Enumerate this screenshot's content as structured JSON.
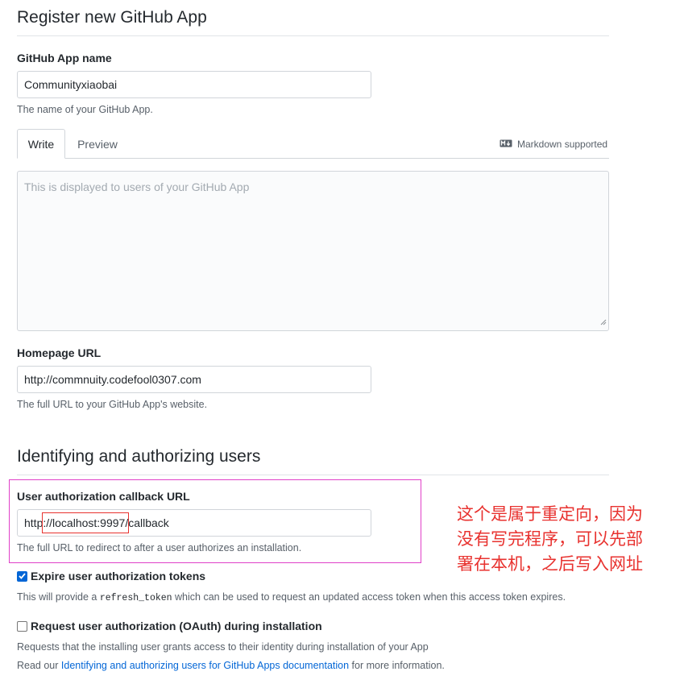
{
  "page": {
    "title": "Register new GitHub App"
  },
  "app_name": {
    "label": "GitHub App name",
    "value": "Communityxiaobai",
    "note": "The name of your GitHub App."
  },
  "description": {
    "tabs": [
      {
        "label": "Write",
        "active": true
      },
      {
        "label": "Preview",
        "active": false
      }
    ],
    "markdown_label": "Markdown supported",
    "placeholder": "This is displayed to users of your GitHub App"
  },
  "homepage": {
    "label": "Homepage URL",
    "value": "http://commnuity.codefool0307.com",
    "note": "The full URL to your GitHub App's website."
  },
  "identify_section": {
    "title": "Identifying and authorizing users"
  },
  "callback": {
    "label": "User authorization callback URL",
    "value_prefix": "http:",
    "value_host": "//localhost:9997",
    "value_suffix": "/callback",
    "note": "The full URL to redirect to after a user authorizes an installation."
  },
  "expire_tokens": {
    "checked": true,
    "label": "Expire user authorization tokens",
    "note_before": "This will provide a ",
    "note_code": "refresh_token",
    "note_after": " which can be used to request an updated access token when this access token expires."
  },
  "oauth_install": {
    "checked": false,
    "label": "Request user authorization (OAuth) during installation",
    "note": "Requests that the installing user grants access to their identity during installation of your App",
    "read_before": "Read our ",
    "read_link": "Identifying and authorizing users for GitHub Apps documentation",
    "read_after": " for more information."
  },
  "annotation": {
    "lines": [
      "这个是属于重定向，因为",
      "没有写完程序，可以先部",
      "署在本机，之后写入网址"
    ]
  },
  "colors": {
    "link": "#0366d6",
    "annotation_text": "#e8322f",
    "highlight_box": "#e040c8",
    "host_box": "#e8322f",
    "checkbox": "#0366d6"
  },
  "icons": {
    "markdown": "markdown-icon",
    "check": "check-icon",
    "resize": "resize-grip-icon"
  }
}
